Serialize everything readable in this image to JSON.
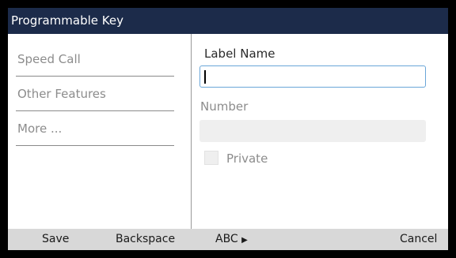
{
  "title": "Programmable Key",
  "sidebar": {
    "items": [
      {
        "label": "Speed Call"
      },
      {
        "label": "Other Features"
      },
      {
        "label": "More ..."
      }
    ]
  },
  "form": {
    "label_name": "Label Name",
    "label_value": "",
    "number_label": "Number",
    "number_value": "",
    "private_label": "Private",
    "private_checked": false
  },
  "softkeys": {
    "save": "Save",
    "backspace": "Backspace",
    "abc": "ABC",
    "abc_arrow": "▶",
    "cancel": "Cancel"
  },
  "colors": {
    "titlebar": "#1c2b4a",
    "focus_border": "#6aa6d8",
    "softkey_bar": "#d8d8d8"
  }
}
